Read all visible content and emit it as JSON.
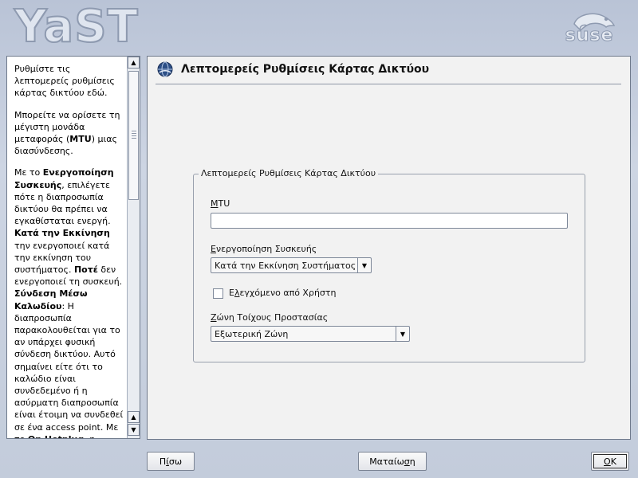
{
  "banner": {
    "app_logo_text": "YaST",
    "vendor_logo_text": "suse"
  },
  "help": {
    "paragraphs": [
      [
        {
          "t": "Ρυθμίστε τις λεπτομερείς ρυθμίσεις κάρτας δικτύου εδώ."
        }
      ],
      [
        {
          "t": "Μπορείτε να ορίσετε τη μέγιστη μονάδα μεταφοράς ("
        },
        {
          "t": "MTU",
          "b": true
        },
        {
          "t": ") μιας διασύνδεσης."
        }
      ],
      [
        {
          "t": "Με το "
        },
        {
          "t": "Ενεργοποίηση Συσκευής",
          "b": true
        },
        {
          "t": ", επιλέγετε πότε η διαπροσωπία δικτύου θα πρέπει να εγκαθίσταται ενεργή. "
        },
        {
          "t": "Κατά την Εκκίνηση",
          "b": true
        },
        {
          "t": " την ενεργοποιεί κατά την εκκίνηση του συστήματος. "
        },
        {
          "t": "Ποτέ",
          "b": true
        },
        {
          "t": " δεν ενεργοποιεί τη συσκευή. "
        },
        {
          "t": "Σύνδεση Μέσω Καλωδίου",
          "b": true
        },
        {
          "t": ": Η διαπροσωπία παρακολουθείται για το αν υπάρχει φυσική σύνδεση δικτύου. Αυτό σημαίνει είτε ότι το καλώδιο είναι συνδεδεμένο ή η ασύρματη διαπροσωπία είναι έτοιμη να συνδεθεί σε ένα access point. Με το "
        },
        {
          "t": "On Hotplug",
          "b": true
        },
        {
          "t": ", η"
        }
      ]
    ]
  },
  "dialog": {
    "title": "Λεπτομερείς Ρυθμίσεις Κάρτας Δικτύου",
    "group_title": "Λεπτομερείς Ρυθμίσεις Κάρτας Δικτύου",
    "mtu": {
      "label_accel": "M",
      "label_rest": "TU",
      "value": ""
    },
    "activation": {
      "label_accel": "Ε",
      "label_rest": "νεργοποίηση Συσκευής",
      "selected": "Κατά την Εκκίνηση Συστήματος"
    },
    "user_controlled": {
      "label_pre": "Ε",
      "label_accel": "λ",
      "label_rest": "εγχόμενο από Χρήστη",
      "checked": false
    },
    "firewall_zone": {
      "label_accel": "Ζ",
      "label_rest": "ώνη Τοίχους Προστασίας",
      "selected": "Εξωτερική Ζώνη"
    }
  },
  "buttons": {
    "back": {
      "pre": "Π",
      "accel": "ί",
      "rest": "σω"
    },
    "abort": {
      "pre": "Ματαίω",
      "accel": "σ",
      "rest": "η"
    },
    "ok": {
      "pre": "",
      "accel": "O",
      "rest": "K"
    }
  },
  "colors": {
    "background": "#c3ccdb",
    "pane": "#f2f2f2",
    "border": "#6f7a8c"
  }
}
